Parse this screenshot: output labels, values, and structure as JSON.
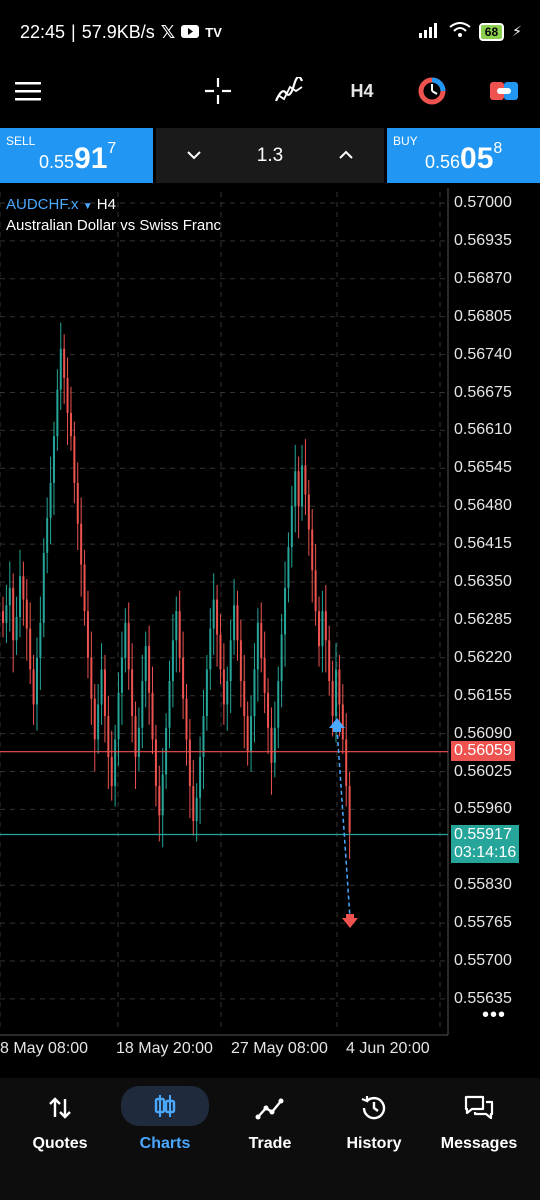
{
  "status_bar": {
    "time": "22:45",
    "network_speed": "57.9KB/s",
    "battery": "68"
  },
  "toolbar": {
    "menu_icon": "hamburger-icon",
    "crosshair_icon": "crosshair-icon",
    "indicators_icon": "indicators-icon",
    "timeframe": "H4",
    "objects_icon": "objects-icon",
    "trade_icon": "trade-icon"
  },
  "trade_bar": {
    "sell_label": "SELL",
    "sell_price_small": "0.55",
    "sell_price_big": "91",
    "sell_price_sup": "7",
    "buy_label": "BUY",
    "buy_price_small": "0.56",
    "buy_price_big": "05",
    "buy_price_sup": "8",
    "lot_size": "1.3"
  },
  "chart": {
    "symbol": "AUDCHF.x",
    "timeframe": "H4",
    "description": "Australian Dollar vs Swiss Franc",
    "price_axis": [
      "0.57000",
      "0.56935",
      "0.56870",
      "0.56805",
      "0.56740",
      "0.56675",
      "0.56610",
      "0.56545",
      "0.56480",
      "0.56415",
      "0.56350",
      "0.56285",
      "0.56220",
      "0.56155",
      "0.56090",
      "0.56025",
      "0.55960",
      "0.55830",
      "0.55765",
      "0.55700",
      "0.55635"
    ],
    "ask_tag": "0.56059",
    "bid_tag": "0.55917",
    "countdown": "03:14:16",
    "time_axis": [
      "8 May 08:00",
      "18 May 20:00",
      "27 May 08:00",
      "4 Jun 20:00"
    ],
    "colors": {
      "bull": "#26a69a",
      "bear": "#ef5350",
      "ask_line": "#ef5350",
      "bid_line": "#26a69a",
      "grid": "#333333"
    }
  },
  "bottom_nav": {
    "items": [
      {
        "label": "Quotes",
        "icon": "quotes-icon"
      },
      {
        "label": "Charts",
        "icon": "charts-icon"
      },
      {
        "label": "Trade",
        "icon": "trade-chart-icon"
      },
      {
        "label": "History",
        "icon": "history-icon"
      },
      {
        "label": "Messages",
        "icon": "messages-icon"
      }
    ]
  }
}
